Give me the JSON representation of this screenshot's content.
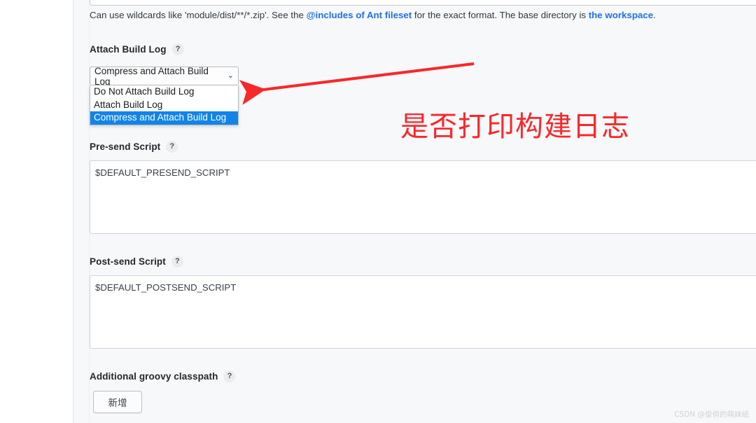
{
  "top_input": {
    "value": ""
  },
  "description": {
    "prefix": "Can use wildcards like 'module/dist/**/*.zip'. See the ",
    "link1": "@includes of Ant fileset",
    "middle": " for the exact format. The base directory is ",
    "link2": "the workspace",
    "suffix": "."
  },
  "attach_build_log": {
    "label": "Attach Build Log",
    "help": "?",
    "selected": "Compress and Attach Build Log",
    "chevron": "⌄",
    "options": [
      {
        "label": "Do Not Attach Build Log",
        "selected": false
      },
      {
        "label": "Attach Build Log",
        "selected": false
      },
      {
        "label": "Compress and Attach Build Log",
        "selected": true
      }
    ]
  },
  "pre_send_script": {
    "label": "Pre-send Script",
    "help": "?",
    "value": "$DEFAULT_PRESEND_SCRIPT"
  },
  "post_send_script": {
    "label": "Post-send Script",
    "help": "?",
    "value": "$DEFAULT_POSTSEND_SCRIPT"
  },
  "additional_groovy_classpath": {
    "label": "Additional groovy classpath",
    "help": "?",
    "add_button": "新增"
  },
  "annotation": {
    "text": "是否打印构建日志",
    "color": "#f8272b",
    "arrow_from": "677,11",
    "arrow_to": "16,52"
  },
  "watermark": {
    "text": "CSDN @俊俏的萌妹纸"
  },
  "colors": {
    "page_background": "#f7f8f9",
    "gutter": "#ffffff",
    "link": "#1f6feb",
    "option_highlight": "#1184e8",
    "annotation_red": "#f8272b"
  }
}
